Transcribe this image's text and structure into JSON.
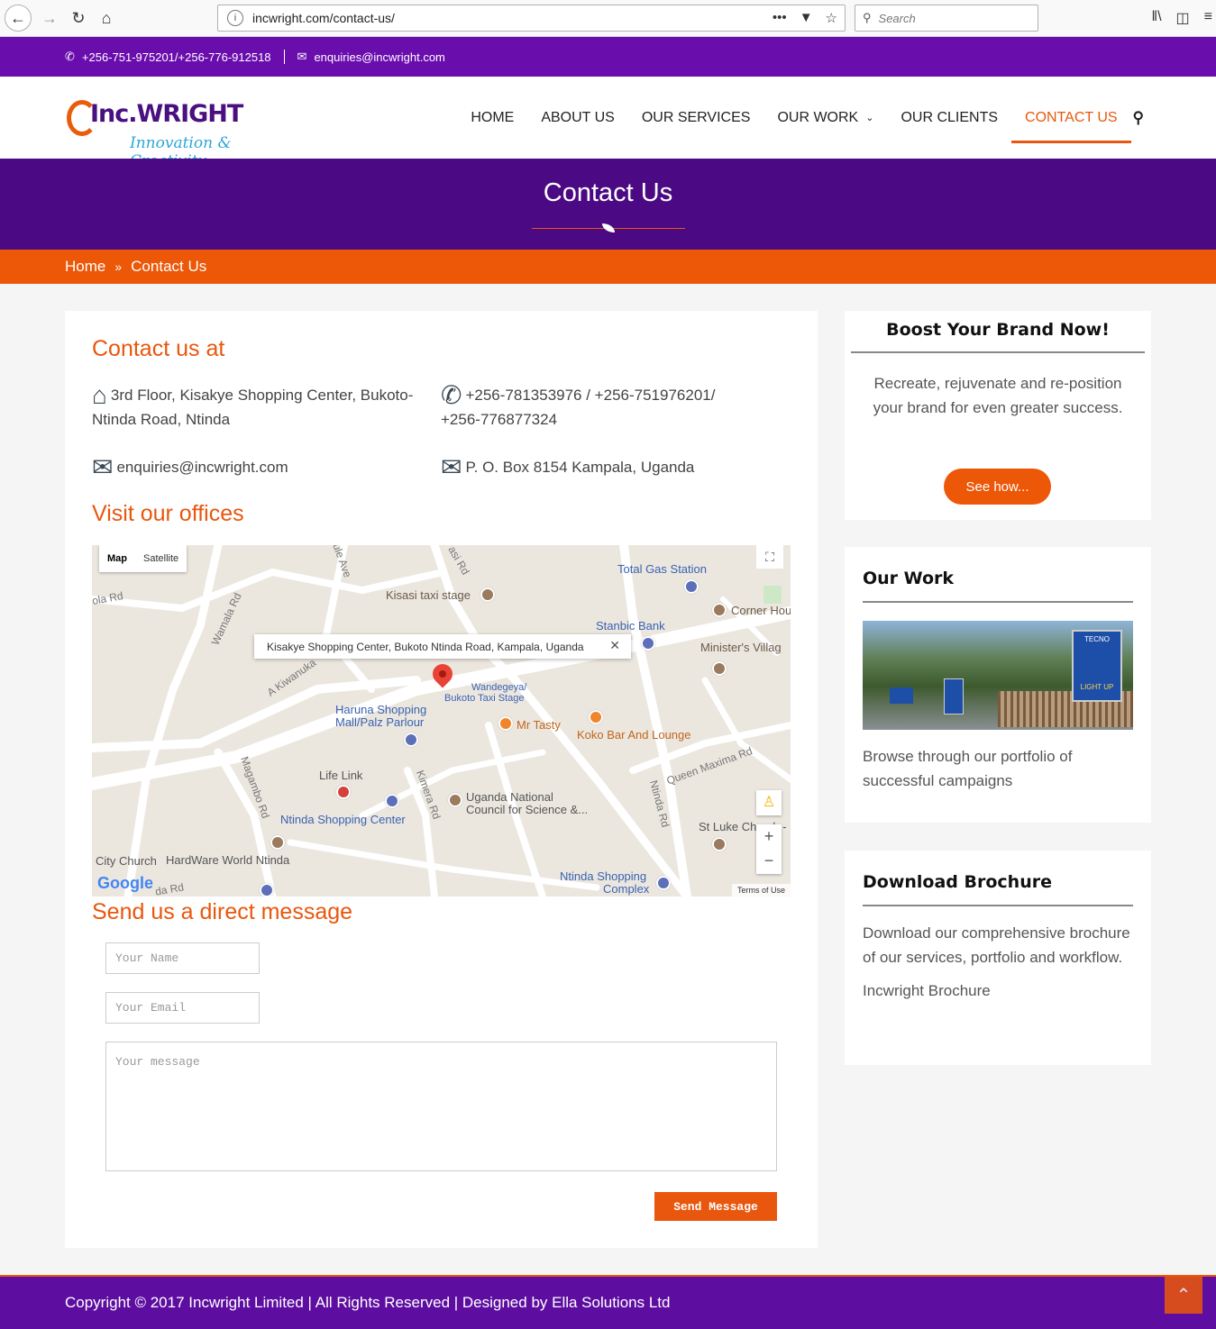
{
  "browser": {
    "url": "incwright.com/contact-us/",
    "search_placeholder": "Search"
  },
  "topbar": {
    "phone": "+256-751-975201/+256-776-912518",
    "email": "enquiries@incwright.com"
  },
  "logo": {
    "brand": "Inc.WRIGHT",
    "tagline": "Innovation & Creativity"
  },
  "nav": {
    "home": "HOME",
    "about": "ABOUT US",
    "services": "OUR SERVICES",
    "work": "OUR WORK",
    "clients": "OUR CLIENTS",
    "contact": "CONTACT US"
  },
  "hero": {
    "title": "Contact Us"
  },
  "breadcrumb": {
    "home": "Home",
    "current": "Contact Us"
  },
  "contact": {
    "heading": "Contact us at",
    "address": "3rd Floor, Kisakye Shopping Center, Bukoto-Ntinda Road, Ntinda",
    "phones": "+256-781353976 / +256-751976201/ +256-776877324",
    "email": "enquiries@incwright.com",
    "pobox": "P. O. Box 8154 Kampala, Uganda"
  },
  "offices": {
    "heading": "Visit our offices",
    "map_tab": "Map",
    "satellite_tab": "Satellite",
    "popup": "Kisakye Shopping Center, Bukoto Ntinda Road, Kampala, Uganda",
    "terms": "Terms of Use",
    "google": "Google",
    "labels": {
      "kisasi_taxi": "Kisasi taxi stage",
      "total": "Total Gas Station",
      "corner": "Corner Hou",
      "stanbic": "Stanbic Bank",
      "ministers": "Minister's Villag",
      "wandegeya1": "Wandegeya/",
      "wandegeya2": "Bukoto Taxi Stage",
      "haruna1": "Haruna Shopping",
      "haruna2": "Mall/Palz Parlour",
      "mrtasty": "Mr Tasty",
      "koko": "Koko Bar And Lounge",
      "lifelink": "Life Link",
      "ntinda_sc": "Ntinda Shopping Center",
      "uncst1": "Uganda National",
      "uncst2": "Council for Science &...",
      "stluke": "St Luke Church -",
      "city_church": "City Church",
      "hardware": "HardWare World Ntinda",
      "ntinda_complex1": "Ntinda Shopping",
      "ntinda_complex2": "Complex",
      "rd_kisasi": "asi Rd",
      "rd_kola": "ola Rd",
      "rd_wamala": "Wamala Rd",
      "rd_ave": "ule Ave",
      "rd_kiwanuka": "A Kiwanuka",
      "rd_magambo": "Magambo Rd",
      "rd_kimera": "Kimera Rd",
      "rd_ntinda": "Ntinda Rd",
      "rd_queen": "Queen Maxima Rd",
      "rd_bottom": "da Rd"
    }
  },
  "form": {
    "heading": "Send us a direct message",
    "name_placeholder": "Your Name",
    "email_placeholder": "Your Email",
    "message_placeholder": "Your message",
    "send": "Send Message"
  },
  "sidebar": {
    "boost": {
      "title": "Boost Your Brand Now!",
      "text": "Recreate, rejuvenate and re-position your brand for even greater success.",
      "button": "See how..."
    },
    "work": {
      "title": "Our Work",
      "billboard": "TECNO",
      "billboard_sub": "LIGHT UP",
      "text": "Browse through our portfolio of successful campaigns"
    },
    "brochure": {
      "title": "Download Brochure",
      "text": "Download our comprehensive brochure of our services, portfolio and workflow.",
      "link": "Incwright Brochure"
    }
  },
  "footer": {
    "text": "Copyright © 2017 Incwright Limited | All Rights Reserved | Designed by Ella Solutions Ltd"
  },
  "colors": {
    "purple": "#6a0dad",
    "dark_purple": "#4b0a83",
    "orange": "#ec5708"
  }
}
